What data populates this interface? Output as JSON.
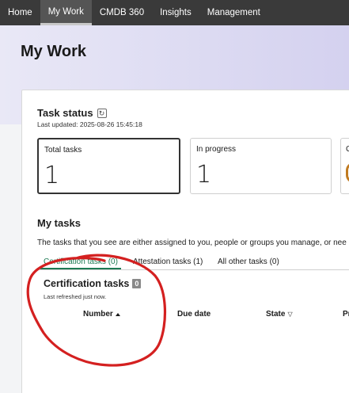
{
  "nav": {
    "items": [
      {
        "label": "Home"
      },
      {
        "label": "My Work"
      },
      {
        "label": "CMDB 360"
      },
      {
        "label": "Insights"
      },
      {
        "label": "Management"
      }
    ]
  },
  "page": {
    "title": "My Work"
  },
  "task_status": {
    "title": "Task status",
    "last_updated": "Last updated: 2025-08-26 15:45:18",
    "cards": [
      {
        "label": "Total tasks",
        "value": "1"
      },
      {
        "label": "In progress",
        "value": "1"
      },
      {
        "label": "C"
      }
    ]
  },
  "my_tasks": {
    "title": "My tasks",
    "description": "The tasks that you see are either assigned to you, people or groups you manage, or nee",
    "tabs": [
      {
        "label": "Certification tasks (0)"
      },
      {
        "label": "Attestation tasks (1)"
      },
      {
        "label": "All other tasks (0)"
      }
    ]
  },
  "certification": {
    "title": "Certification tasks",
    "count": "0",
    "last_refreshed": "Last refreshed just now.",
    "columns": [
      {
        "label": "Number"
      },
      {
        "label": "Due date"
      },
      {
        "label": "State"
      },
      {
        "label": "Pr"
      }
    ]
  },
  "colors": {
    "nav_bg": "#3a3a3a",
    "active_tab": "#1e7a54",
    "annotation": "#d42020"
  }
}
